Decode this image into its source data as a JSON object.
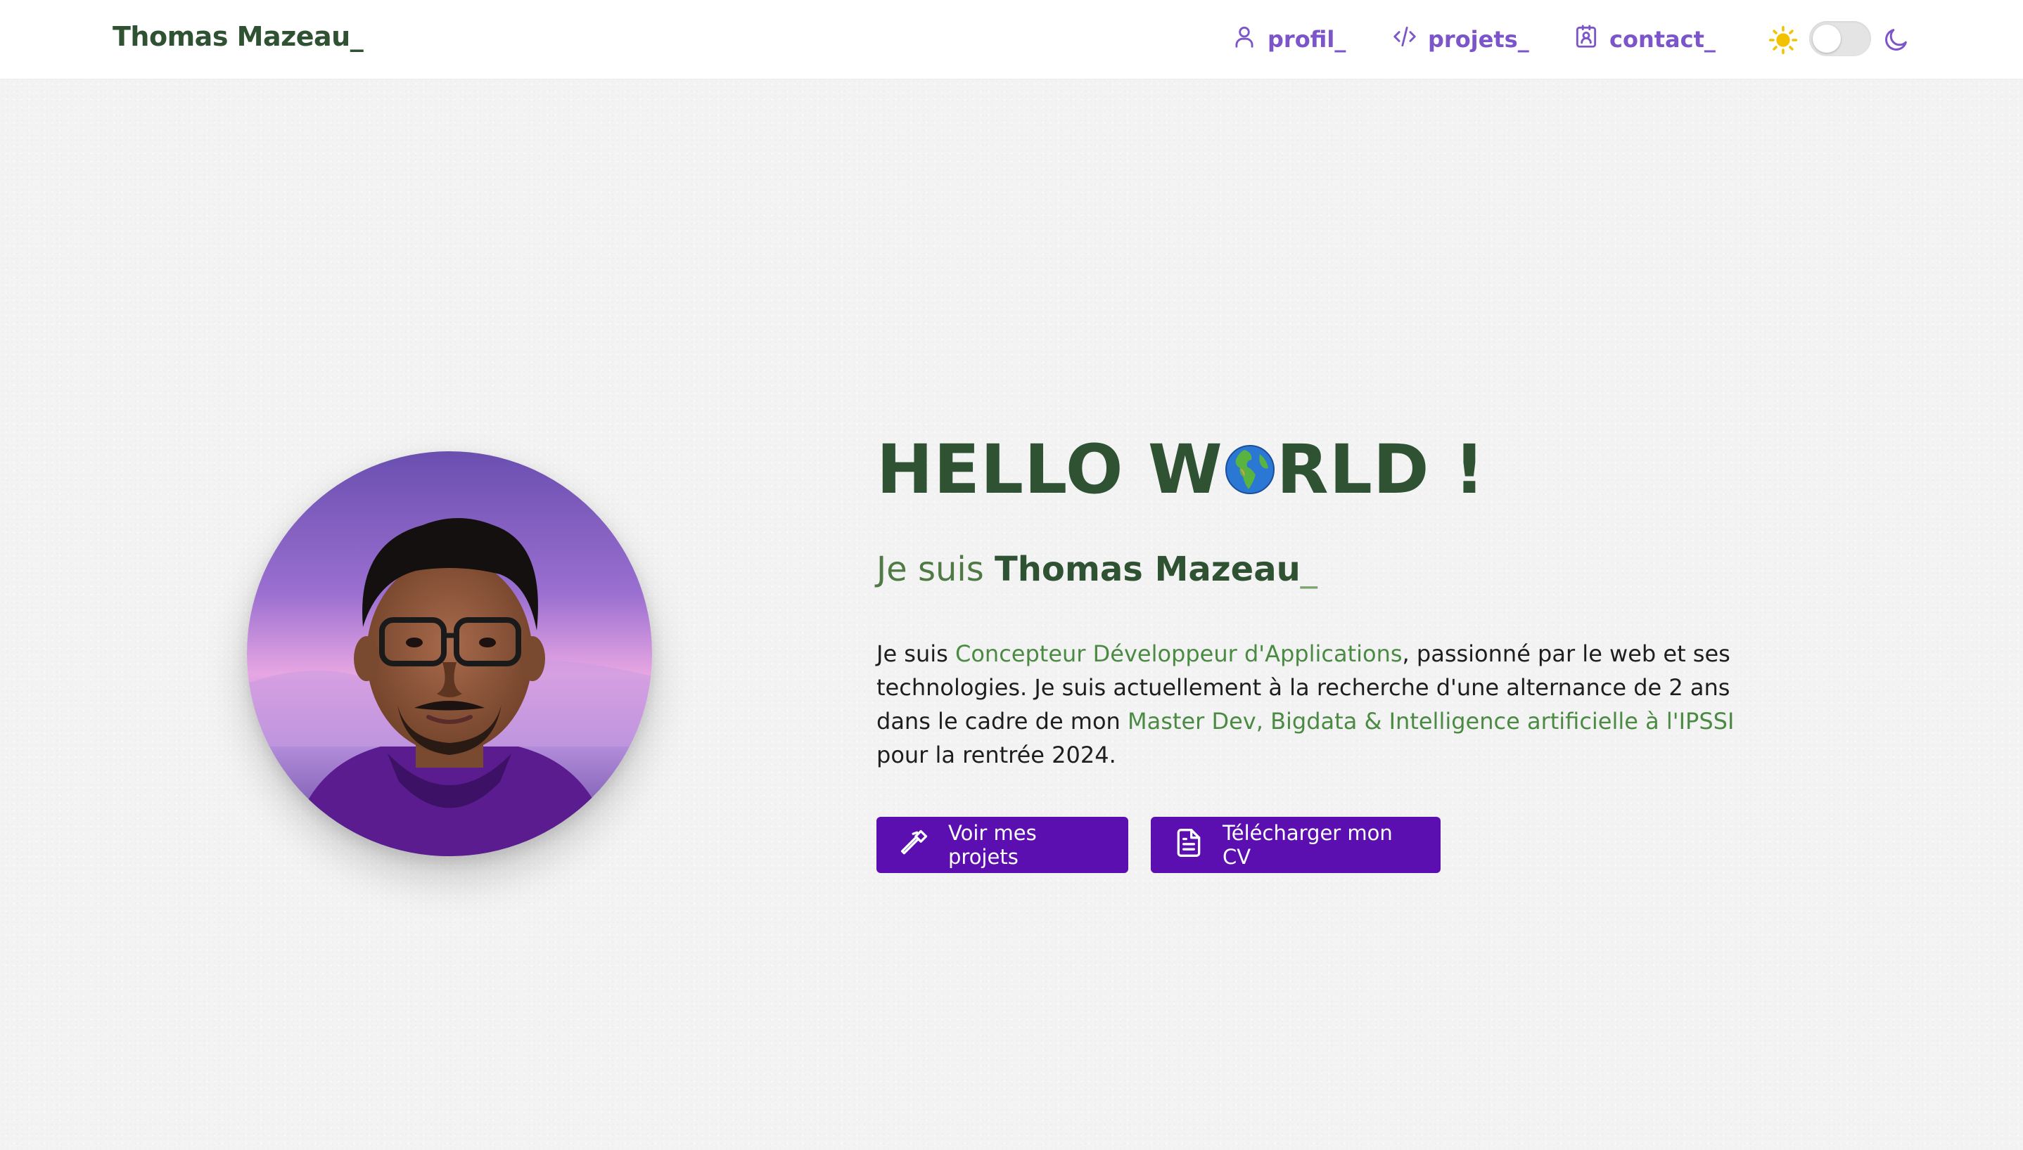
{
  "header": {
    "brand": "Thomas Mazeau_",
    "nav": [
      {
        "label": "profil_",
        "icon": "user-icon"
      },
      {
        "label": "projets_",
        "icon": "code-icon"
      },
      {
        "label": "contact_",
        "icon": "contact-card-icon"
      }
    ],
    "theme": {
      "light_icon": "sun-icon",
      "dark_icon": "moon-icon",
      "dark_mode": false
    }
  },
  "hero": {
    "title_before": "HELLO W",
    "title_after": "RLD !",
    "title_icon": "globe-icon",
    "subtitle_prefix": "Je suis ",
    "subtitle_name": "Thomas Mazeau",
    "subtitle_cursor": "_",
    "desc": {
      "t1": "Je suis ",
      "h1": "Concepteur Développeur d'Applications",
      "t2": ", passionné par le web et ses technologies. Je suis actuellement à la recherche d'une alternance de 2 ans dans le cadre de mon ",
      "h2": "Master Dev, Bigdata & Intelligence artificielle à l'IPSSI",
      "t3": " pour la rentrée 2024."
    },
    "buttons": [
      {
        "label": "Voir mes projets",
        "icon": "hammer-icon"
      },
      {
        "label": "Télécharger mon CV",
        "icon": "document-icon"
      }
    ]
  },
  "colors": {
    "brand_green": "#2f5233",
    "accent_green": "#4a8a42",
    "nav_purple": "#7b55c9",
    "button_purple": "#5b0fb0",
    "sun_yellow": "#f2c200"
  }
}
